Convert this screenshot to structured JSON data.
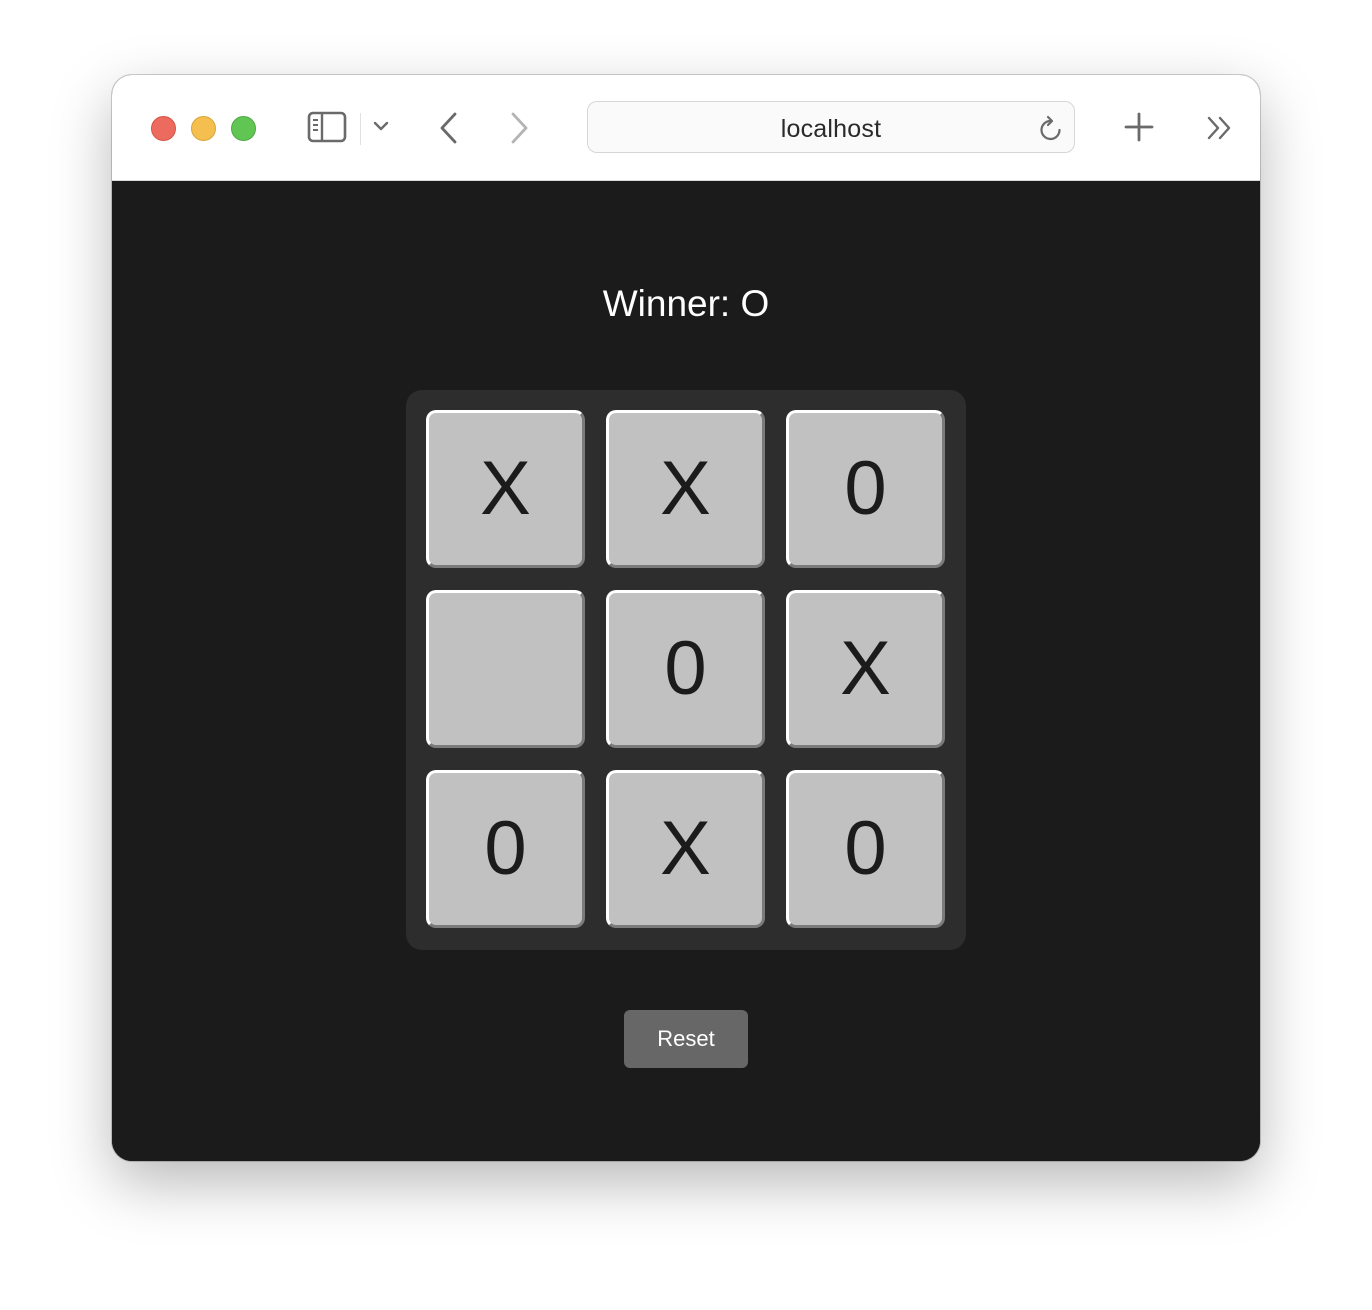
{
  "browser": {
    "address": "localhost",
    "icons": [
      "sidebar-icon",
      "chevron-down-icon",
      "back-arrow-icon",
      "forward-arrow-icon",
      "reload-icon",
      "plus-icon",
      "more-chevrons-icon"
    ]
  },
  "game": {
    "status": "Winner: O",
    "board": [
      "X",
      "X",
      "0",
      "",
      "0",
      "X",
      "0",
      "X",
      "0"
    ],
    "reset_label": "Reset"
  },
  "colors": {
    "page_background": "#1b1b1b",
    "board_background": "#2d2d2d",
    "cell_background": "#c1c1c1",
    "reset_button": "#676767",
    "close": "#ec6a5e",
    "minimize": "#f4bf4f",
    "maximize": "#61c554"
  }
}
